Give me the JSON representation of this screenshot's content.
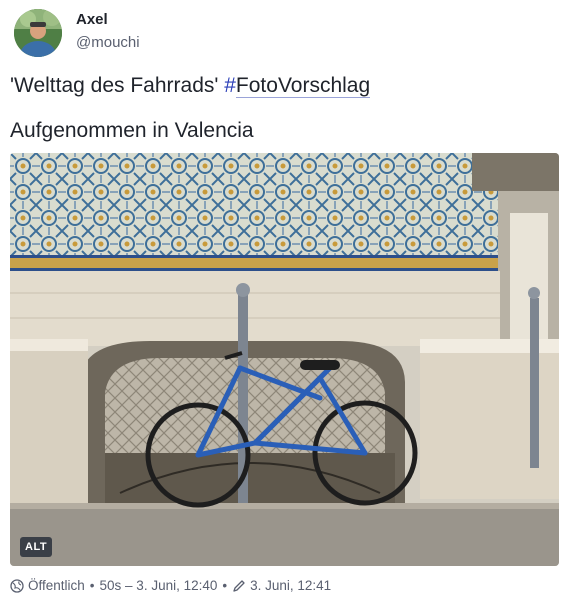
{
  "author": {
    "name": "Axel",
    "handle": "@mouchi"
  },
  "post": {
    "text_prefix": "'Welttag des Fahrrads' ",
    "hashtag_symbol": "#",
    "hashtag_text": "FotoVorschlag",
    "line2": "Aufgenommen in Valencia",
    "hashtag_color": "#2b3fb8"
  },
  "media": {
    "alt_label": "ALT"
  },
  "meta": {
    "visibility_icon": "globe-icon",
    "visibility": "Öffentlich",
    "sep1": "•",
    "posted": "50s – 3. Juni, 12:40",
    "sep2": "•",
    "edited_icon": "pencil-icon",
    "edited": "3. Juni, 12:41"
  }
}
